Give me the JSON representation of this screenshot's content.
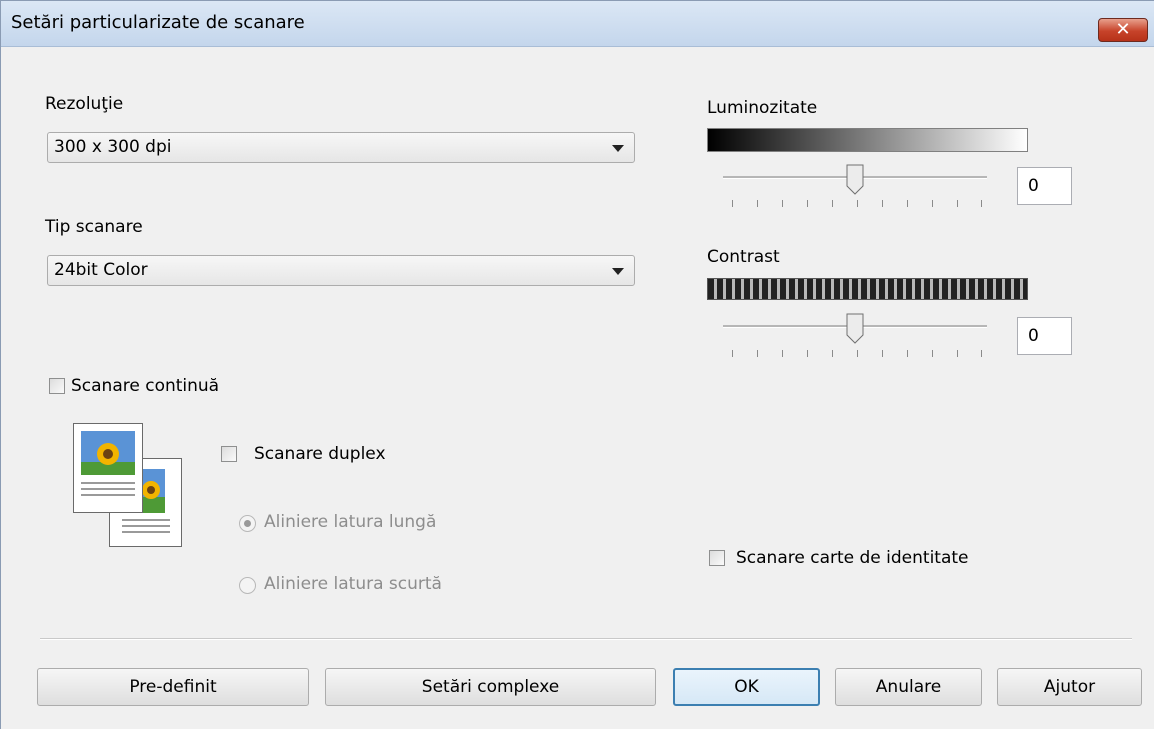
{
  "window": {
    "title": "Setări particularizate de scanare"
  },
  "resolution": {
    "label": "Rezoluţie",
    "value": "300 x 300 dpi"
  },
  "scan_type": {
    "label": "Tip scanare",
    "value": "24bit Color"
  },
  "brightness": {
    "label": "Luminozitate",
    "value": "0"
  },
  "contrast": {
    "label": "Contrast",
    "value": "0"
  },
  "options": {
    "continuous_scan": "Scanare continuă",
    "duplex_scan": "Scanare duplex",
    "long_edge": "Aliniere latura lungă",
    "short_edge": "Aliniere latura scurtă",
    "id_card_scan": "Scanare carte de identitate"
  },
  "buttons": {
    "default": "Pre-definit",
    "advanced": "Setări complexe",
    "ok": "OK",
    "cancel": "Anulare",
    "help": "Ajutor"
  },
  "icons": {
    "close": "close-icon",
    "duplex": "duplex-documents-icon"
  }
}
